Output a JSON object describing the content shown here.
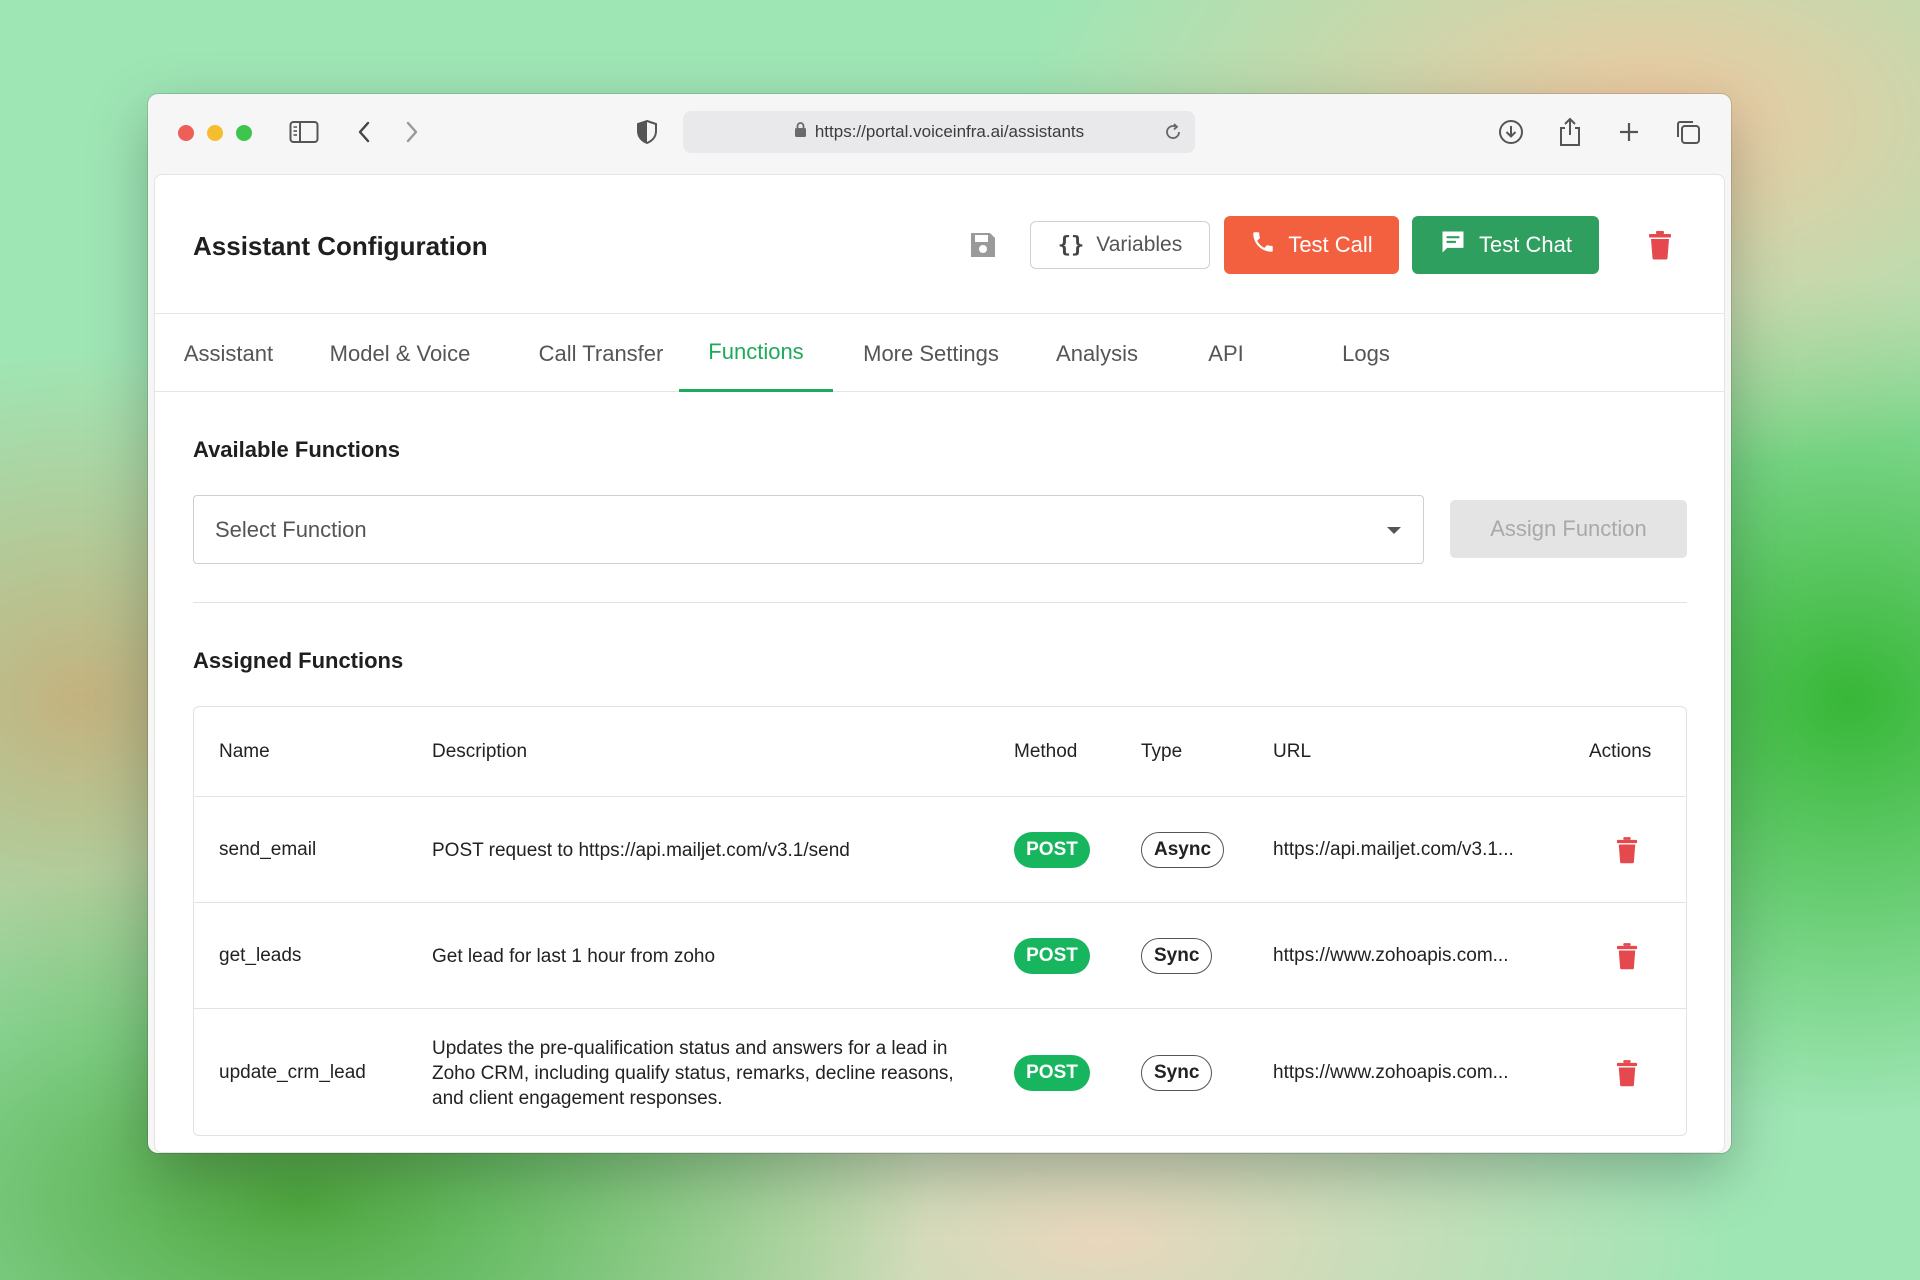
{
  "browser": {
    "url": "https://portal.voiceinfra.ai/assistants"
  },
  "header": {
    "title": "Assistant Configuration",
    "variables_label": "Variables",
    "test_call_label": "Test Call",
    "test_chat_label": "Test Chat"
  },
  "tabs": [
    {
      "label": "Assistant",
      "active": false
    },
    {
      "label": "Model & Voice",
      "active": false
    },
    {
      "label": "Call Transfer",
      "active": false
    },
    {
      "label": "Functions",
      "active": true
    },
    {
      "label": "More Settings",
      "active": false
    },
    {
      "label": "Analysis",
      "active": false
    },
    {
      "label": "API",
      "active": false
    },
    {
      "label": "Logs",
      "active": false
    }
  ],
  "available": {
    "title": "Available Functions",
    "select_placeholder": "Select Function",
    "assign_label": "Assign Function"
  },
  "assigned": {
    "title": "Assigned Functions",
    "columns": {
      "name": "Name",
      "description": "Description",
      "method": "Method",
      "type": "Type",
      "url": "URL",
      "actions": "Actions"
    },
    "rows": [
      {
        "name": "send_email",
        "description": "POST request to https://api.mailjet.com/v3.1/send",
        "method": "POST",
        "type": "Async",
        "url": "https://api.mailjet.com/v3.1..."
      },
      {
        "name": "get_leads",
        "description": "Get lead for last 1 hour from zoho",
        "method": "POST",
        "type": "Sync",
        "url": "https://www.zohoapis.com..."
      },
      {
        "name": "update_crm_lead",
        "description": "Updates the pre-qualification status and answers for a lead in Zoho CRM, including qualify status, remarks, decline reasons, and client engagement responses.",
        "method": "POST",
        "type": "Sync",
        "url": "https://www.zohoapis.com..."
      }
    ]
  },
  "colors": {
    "accent_green": "#1faa5a",
    "test_call": "#f2603f",
    "test_chat": "#2e9f5e",
    "method_post": "#17b55e",
    "delete_red": "#e5484d"
  }
}
